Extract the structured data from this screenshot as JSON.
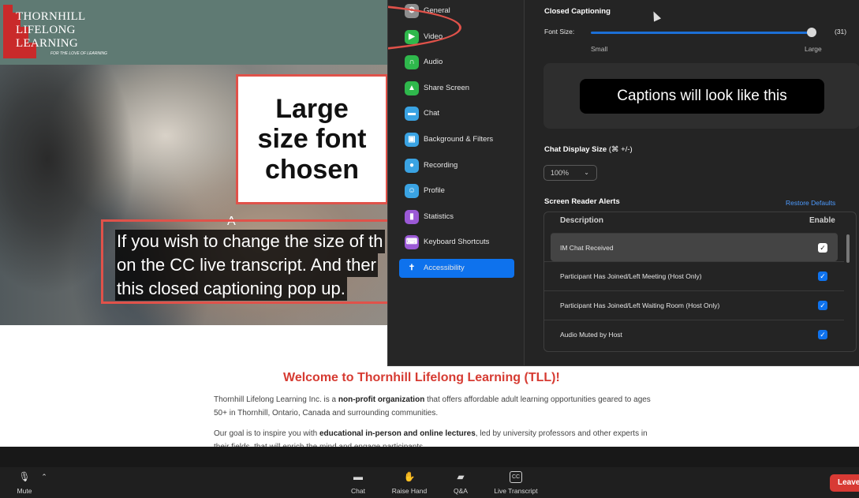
{
  "website": {
    "logo": {
      "line1": "THORNHILL",
      "line2": "LIFELONG",
      "line3": "LEARNING",
      "tagline": "FOR THE LOVE OF LEARNING"
    },
    "hero_letter": "A",
    "callout": "Large size font chosen",
    "caption_lines": [
      "If you wish to change the size of th",
      "on the CC live transcript. And ther",
      "this closed captioning pop up."
    ],
    "welcome_title": "Welcome to Thornhill Lifelong Learning (TLL)!",
    "para1_start": "Thornhill Lifelong Learning Inc. is a ",
    "para1_bold": "non-profit organization",
    "para1_end": " that offers affordable adult learning opportunities geared to ages 50+ in Thornhill, Ontario, Canada and surrounding communities.",
    "para2_start": "Our goal is to inspire you with ",
    "para2_bold": "educational in-person and online lectures",
    "para2_end": ", led by university professors and other experts in their fields, that will enrich the mind and engage participants."
  },
  "settings": {
    "nav": [
      {
        "label": "General",
        "icon": "gear-icon",
        "color": "#8e8e8e"
      },
      {
        "label": "Video",
        "icon": "video-icon",
        "color": "#2fb84c"
      },
      {
        "label": "Audio",
        "icon": "headphones-icon",
        "color": "#2fb84c"
      },
      {
        "label": "Share Screen",
        "icon": "share-screen-icon",
        "color": "#2fb84c"
      },
      {
        "label": "Chat",
        "icon": "chat-icon",
        "color": "#3aa3e3"
      },
      {
        "label": "Background & Filters",
        "icon": "background-icon",
        "color": "#3aa3e3"
      },
      {
        "label": "Recording",
        "icon": "recording-icon",
        "color": "#3aa3e3"
      },
      {
        "label": "Profile",
        "icon": "profile-icon",
        "color": "#3aa3e3"
      },
      {
        "label": "Statistics",
        "icon": "statistics-icon",
        "color": "#9b59d6"
      },
      {
        "label": "Keyboard Shortcuts",
        "icon": "keyboard-icon",
        "color": "#9b59d6"
      },
      {
        "label": "Accessibility",
        "icon": "accessibility-icon",
        "color": "#0e72ed"
      }
    ],
    "closed_captioning": {
      "heading": "Closed Captioning",
      "font_size_label": "Font Size:",
      "font_size_value": "(31)",
      "slider_fraction": 0.98,
      "small_label": "Small",
      "large_label": "Large",
      "preview_text": "Captions will look like this"
    },
    "chat_display": {
      "label": "Chat Display Size",
      "shortcut": "(⌘ +/-)",
      "selected": "100%"
    },
    "screen_reader": {
      "heading": "Screen Reader Alerts",
      "restore": "Restore Defaults",
      "col_description": "Description",
      "col_enable": "Enable",
      "rows": [
        {
          "label": "IM Chat Received",
          "enabled": true
        },
        {
          "label": "Participant Has Joined/Left Meeting (Host Only)",
          "enabled": true
        },
        {
          "label": "Participant Has Joined/Left Waiting Room (Host Only)",
          "enabled": true
        },
        {
          "label": "Audio Muted by Host",
          "enabled": true
        }
      ]
    }
  },
  "toolbar": {
    "mute": "Mute",
    "chat": "Chat",
    "raise_hand": "Raise Hand",
    "qa": "Q&A",
    "live_transcript": "Live Transcript",
    "cc_glyph": "CC",
    "leave": "Leave"
  },
  "colors": {
    "accent": "#0e72ed",
    "annotation": "#e0524a",
    "brand_red": "#d63b32",
    "leave": "#d83a34"
  }
}
